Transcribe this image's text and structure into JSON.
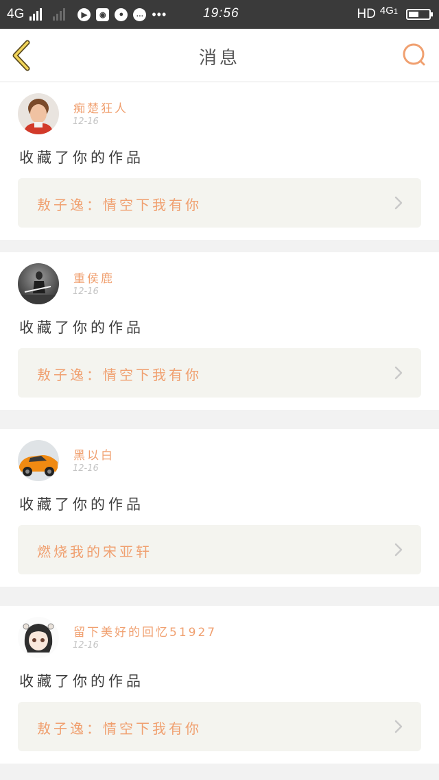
{
  "status_bar": {
    "network": "4G",
    "time": "19:56",
    "hd": "HD",
    "network_right": "4G",
    "sim_badge": "1"
  },
  "nav": {
    "title": "消息",
    "back_icon": "chevron-left-icon",
    "search_icon": "search-icon",
    "accent_color": "#f0a070"
  },
  "messages": [
    {
      "username": "痴楚狂人",
      "date": "12-16",
      "action": "收藏了你的作品",
      "work_title": "敖子逸：情空下我有你",
      "avatar": "child-photo"
    },
    {
      "username": "重侯鹿",
      "date": "12-16",
      "action": "收藏了你的作品",
      "work_title": "敖子逸：情空下我有你",
      "avatar": "figure-with-sword"
    },
    {
      "username": "黑以白",
      "date": "12-16",
      "action": "收藏了你的作品",
      "work_title": "燃烧我的宋亚轩",
      "avatar": "orange-car"
    },
    {
      "username": "留下美好的回忆51927",
      "date": "12-16",
      "action": "收藏了你的作品",
      "work_title": "敖子逸：情空下我有你",
      "avatar": "anime-girl"
    }
  ]
}
